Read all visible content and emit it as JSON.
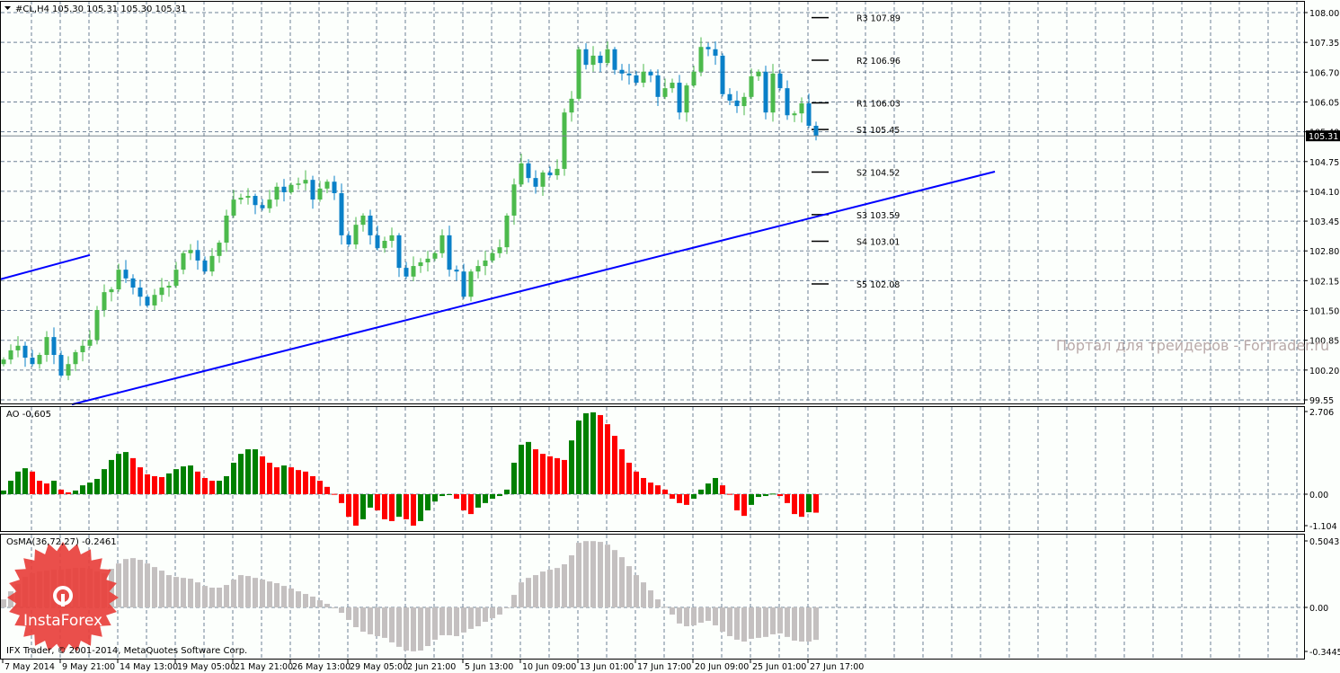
{
  "header": {
    "symbol": "#CL,H4",
    "quote": "105.30 105.31 105.30 105.31",
    "menu_icon": "triangle-down-icon"
  },
  "watermark": "Портал для трейдеров - ForTrader.ru",
  "logo_text": "InstaForex",
  "copyright": "IFX Trader, © 2001-2014, MetaQuotes Software Corp.",
  "colors": {
    "bull": "#4cba4c",
    "bear": "#0a80c8",
    "trendline": "#0000ff",
    "grid": "#6e8096",
    "ao_up": "#008000",
    "ao_down": "#ff0000",
    "osma": "#c4c0c0",
    "logo": "#e8403c"
  },
  "chart_data": [
    {
      "type": "candlestick",
      "title": "#CL,H4",
      "ylim": [
        99.55,
        108.0
      ],
      "price_ticks": [
        "108.00",
        "107.35",
        "106.70",
        "106.05",
        "105.40",
        "104.75",
        "104.10",
        "103.45",
        "102.80",
        "102.15",
        "101.50",
        "100.85",
        "100.20",
        "99.55"
      ],
      "current_price": "105.31",
      "time_labels": [
        "7 May 2014",
        "9 May 21:00",
        "14 May 13:00",
        "19 May 05:00",
        "21 May 21:00",
        "26 May 13:00",
        "29 May 05:00",
        "2 Jun 21:00",
        "5 Jun 13:00",
        "10 Jun 09:00",
        "13 Jun 01:00",
        "17 Jun 17:00",
        "20 Jun 09:00",
        "25 Jun 01:00",
        "27 Jun 17:00"
      ],
      "closes": [
        100.43,
        100.63,
        100.73,
        100.47,
        100.33,
        100.53,
        100.92,
        100.53,
        100.08,
        100.33,
        100.59,
        100.73,
        100.86,
        101.51,
        101.9,
        101.96,
        102.39,
        102.2,
        102.0,
        101.8,
        101.61,
        101.84,
        102.0,
        102.04,
        102.39,
        102.75,
        102.82,
        102.59,
        102.35,
        102.69,
        102.98,
        103.57,
        103.92,
        103.96,
        104.0,
        103.8,
        103.73,
        103.92,
        104.2,
        104.08,
        104.24,
        104.27,
        104.35,
        103.92,
        104.16,
        104.31,
        104.06,
        103.14,
        102.94,
        103.37,
        103.57,
        103.14,
        102.86,
        103.02,
        103.14,
        102.43,
        102.24,
        102.47,
        102.55,
        102.63,
        102.75,
        103.14,
        102.39,
        102.35,
        101.8,
        102.35,
        102.47,
        102.59,
        102.75,
        102.88,
        103.57,
        104.25,
        104.71,
        104.39,
        104.2,
        104.51,
        104.45,
        104.59,
        105.82,
        106.12,
        107.2,
        106.86,
        107.06,
        106.9,
        107.2,
        106.75,
        106.67,
        106.63,
        106.47,
        106.71,
        106.63,
        106.16,
        106.35,
        106.47,
        105.82,
        106.41,
        106.71,
        107.25,
        107.2,
        107.06,
        106.22,
        106.08,
        105.96,
        106.16,
        106.61,
        106.71,
        105.82,
        106.67,
        106.35,
        105.76,
        105.8,
        106.02,
        105.53,
        105.31
      ],
      "pivots": [
        {
          "label": "R3 107.89",
          "value": 107.89
        },
        {
          "label": "R2 106.96",
          "value": 106.96
        },
        {
          "label": "R1 106.03",
          "value": 106.03
        },
        {
          "label": "S1 105.45",
          "value": 105.45
        },
        {
          "label": "S2 104.52",
          "value": 104.52
        },
        {
          "label": "S3 103.59",
          "value": 103.59
        },
        {
          "label": "S4 103.01",
          "value": 103.01
        },
        {
          "label": "S5 102.08",
          "value": 102.08
        }
      ],
      "trendlines": [
        {
          "from_price": 102.18,
          "to_price": 102.71
        },
        {
          "from_price": 99.45,
          "to_price": 104.53
        }
      ]
    },
    {
      "type": "histogram",
      "title": "AO -0,605",
      "ylim": [
        -1.104,
        2.706
      ],
      "ticks": [
        "2.706",
        "0.00",
        "-1.104"
      ],
      "values": [
        0.12,
        0.44,
        0.74,
        0.85,
        0.74,
        0.44,
        0.35,
        0.44,
        0.15,
        0.06,
        0.12,
        0.29,
        0.38,
        0.5,
        0.82,
        1.12,
        1.32,
        1.38,
        1.18,
        0.88,
        0.65,
        0.59,
        0.56,
        0.68,
        0.82,
        0.91,
        0.94,
        0.74,
        0.53,
        0.44,
        0.44,
        0.59,
        1.03,
        1.32,
        1.47,
        1.47,
        1.24,
        1.03,
        0.88,
        0.94,
        0.88,
        0.79,
        0.74,
        0.59,
        0.44,
        0.24,
        0.01,
        -0.29,
        -0.74,
        -1.03,
        -0.82,
        -0.44,
        -0.53,
        -0.82,
        -0.88,
        -0.74,
        -0.82,
        -1.03,
        -0.88,
        -0.53,
        -0.24,
        -0.06,
        -0.01,
        -0.15,
        -0.53,
        -0.65,
        -0.44,
        -0.29,
        -0.15,
        -0.06,
        0.15,
        1.03,
        1.62,
        1.71,
        1.47,
        1.32,
        1.24,
        1.18,
        1.12,
        1.76,
        2.41,
        2.65,
        2.68,
        2.59,
        2.29,
        1.91,
        1.47,
        1.03,
        0.74,
        0.53,
        0.38,
        0.29,
        0.15,
        -0.15,
        -0.29,
        -0.35,
        -0.15,
        0.15,
        0.35,
        0.53,
        0.29,
        0.01,
        -0.53,
        -0.71,
        -0.35,
        -0.09,
        -0.06,
        0.02,
        -0.06,
        -0.29,
        -0.65,
        -0.74,
        -0.59,
        -0.605
      ]
    },
    {
      "type": "histogram",
      "title": "OsMA(36,72,27) -0.2461",
      "ylim": [
        -0.3445,
        0.5043
      ],
      "ticks": [
        "0.5043",
        "0.00",
        "-0.3445"
      ],
      "values": [
        0.061,
        0.122,
        0.177,
        0.231,
        0.259,
        0.272,
        0.279,
        0.286,
        0.286,
        0.293,
        0.299,
        0.299,
        0.293,
        0.272,
        0.259,
        0.293,
        0.333,
        0.367,
        0.374,
        0.361,
        0.333,
        0.306,
        0.279,
        0.245,
        0.231,
        0.224,
        0.218,
        0.19,
        0.163,
        0.15,
        0.15,
        0.17,
        0.211,
        0.245,
        0.238,
        0.224,
        0.211,
        0.197,
        0.184,
        0.163,
        0.143,
        0.122,
        0.102,
        0.082,
        0.054,
        0.027,
        -0.007,
        -0.041,
        -0.095,
        -0.15,
        -0.184,
        -0.204,
        -0.218,
        -0.231,
        -0.265,
        -0.299,
        -0.327,
        -0.333,
        -0.327,
        -0.293,
        -0.245,
        -0.211,
        -0.211,
        -0.218,
        -0.19,
        -0.163,
        -0.143,
        -0.109,
        -0.082,
        -0.054,
        -0.007,
        0.095,
        0.19,
        0.224,
        0.245,
        0.272,
        0.286,
        0.299,
        0.327,
        0.395,
        0.49,
        0.503,
        0.503,
        0.497,
        0.476,
        0.435,
        0.381,
        0.313,
        0.245,
        0.19,
        0.129,
        0.061,
        0.005,
        -0.054,
        -0.122,
        -0.143,
        -0.136,
        -0.116,
        -0.102,
        -0.136,
        -0.184,
        -0.218,
        -0.245,
        -0.259,
        -0.238,
        -0.231,
        -0.224,
        -0.204,
        -0.197,
        -0.224,
        -0.252,
        -0.259,
        -0.259,
        -0.2461
      ]
    }
  ]
}
